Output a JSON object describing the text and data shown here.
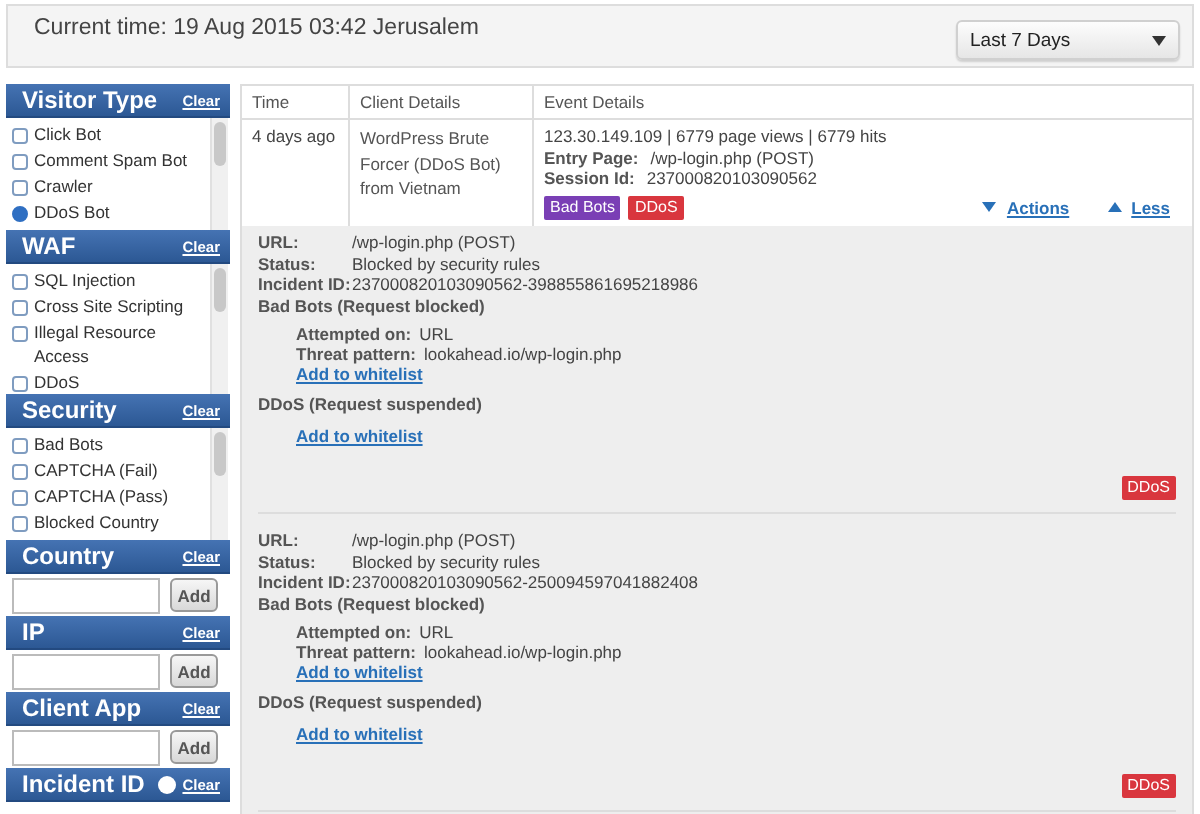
{
  "header": {
    "current_time": "Current time: 19 Aug 2015 03:42 Jerusalem",
    "range_select": {
      "value": "Last 7 Days"
    }
  },
  "sidebar": {
    "filters": [
      {
        "kind": "checklist",
        "title": "Visitor Type",
        "clear": "Clear",
        "items": [
          {
            "label": "Click Bot",
            "checked": false
          },
          {
            "label": "Comment Spam Bot",
            "checked": false
          },
          {
            "label": "Crawler",
            "checked": false
          },
          {
            "label": "DDoS Bot",
            "checked": true
          }
        ]
      },
      {
        "kind": "checklist",
        "title": "WAF",
        "clear": "Clear",
        "items": [
          {
            "label": "SQL Injection",
            "checked": false
          },
          {
            "label": "Cross Site Scripting",
            "checked": false
          },
          {
            "label": "Illegal Resource Access",
            "checked": false
          },
          {
            "label": "DDoS",
            "checked": false
          }
        ]
      },
      {
        "kind": "checklist",
        "title": "Security",
        "clear": "Clear",
        "items": [
          {
            "label": "Bad Bots",
            "checked": false
          },
          {
            "label": "CAPTCHA (Fail)",
            "checked": false
          },
          {
            "label": "CAPTCHA (Pass)",
            "checked": false
          },
          {
            "label": "Blocked Country",
            "checked": false
          }
        ]
      },
      {
        "kind": "text",
        "title": "Country",
        "clear": "Clear",
        "add_button": "Add"
      },
      {
        "kind": "text",
        "title": "IP",
        "clear": "Clear",
        "add_button": "Add"
      },
      {
        "kind": "text",
        "title": "Client App",
        "clear": "Clear",
        "add_button": "Add"
      },
      {
        "kind": "collapsed",
        "title": "Incident ID",
        "clear": "Clear",
        "help": true
      }
    ]
  },
  "table": {
    "columns": [
      "Time",
      "Client Details",
      "Event Details"
    ],
    "rows": [
      {
        "time": "4 days ago",
        "client": "WordPress Brute Forcer (DDoS Bot) from Vietnam",
        "summary": "123.30.149.109 | 6779 page views | 6779 hits",
        "fields": [
          {
            "label": "Entry Page:",
            "value": "/wp-login.php (POST)"
          },
          {
            "label": "Session Id:",
            "value": "237000820103090562"
          }
        ],
        "tags": [
          {
            "label": "Bad Bots",
            "color": "#7a3fb5"
          },
          {
            "label": "DDoS",
            "color": "#d9363e"
          }
        ],
        "actions_link": "Actions",
        "less_link": "Less"
      }
    ]
  },
  "details": [
    {
      "fields": [
        {
          "label": "URL:",
          "value": "/wp-login.php (POST)"
        },
        {
          "label": "Status:",
          "value": "Blocked by security rules"
        },
        {
          "label": "Incident ID:",
          "value": "237000820103090562-398855861695218986"
        }
      ],
      "rules": [
        {
          "title": "Bad Bots (Request blocked)",
          "fields": [
            {
              "label": "Attempted on:",
              "value": "URL"
            },
            {
              "label": "Threat pattern:",
              "value": "lookahead.io/wp-login.php"
            }
          ],
          "link": "Add to whitelist"
        },
        {
          "title": "DDoS (Request suspended)",
          "link": "Add to whitelist"
        }
      ],
      "tag": {
        "label": "DDoS",
        "color": "#d9363e"
      }
    },
    {
      "fields": [
        {
          "label": "URL:",
          "value": "/wp-login.php (POST)"
        },
        {
          "label": "Status:",
          "value": "Blocked by security rules"
        },
        {
          "label": "Incident ID:",
          "value": "237000820103090562-250094597041882408"
        }
      ],
      "rules": [
        {
          "title": "Bad Bots (Request blocked)",
          "fields": [
            {
              "label": "Attempted on:",
              "value": "URL"
            },
            {
              "label": "Threat pattern:",
              "value": "lookahead.io/wp-login.php"
            }
          ],
          "link": "Add to whitelist"
        },
        {
          "title": "DDoS (Request suspended)",
          "link": "Add to whitelist"
        }
      ],
      "tag": {
        "label": "DDoS",
        "color": "#d9363e"
      }
    }
  ]
}
